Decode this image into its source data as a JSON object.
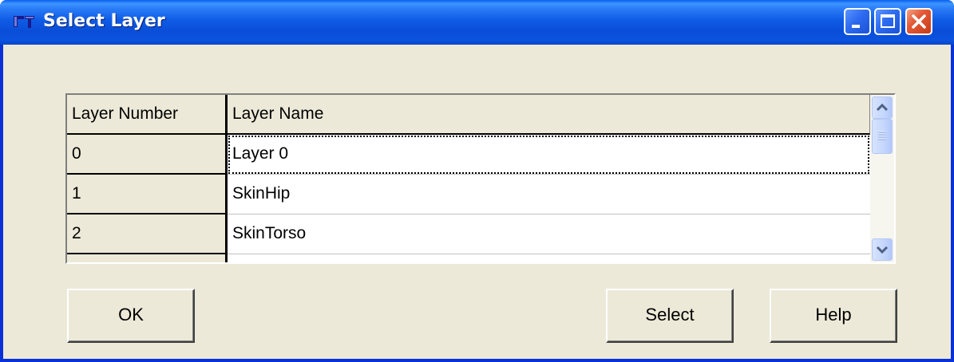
{
  "window": {
    "title": "Select Layer",
    "title_bar_color": "#0A4ED8",
    "body_color": "#ECE9D8",
    "controls": {
      "minimize": "minimize-icon",
      "maximize": "maximize-icon",
      "close": "close-icon"
    }
  },
  "grid": {
    "columns": [
      "Layer Number",
      "Layer Name"
    ],
    "rows": [
      {
        "number": "0",
        "name": "Layer 0"
      },
      {
        "number": "1",
        "name": "SkinHip"
      },
      {
        "number": "2",
        "name": "SkinTorso"
      }
    ],
    "selected_row": 0,
    "scrollbar": {
      "up_icon": "chevron-up-icon",
      "down_icon": "chevron-down-icon",
      "thumb_position": 0.0
    }
  },
  "buttons": {
    "ok": "OK",
    "select": "Select",
    "help": "Help"
  }
}
